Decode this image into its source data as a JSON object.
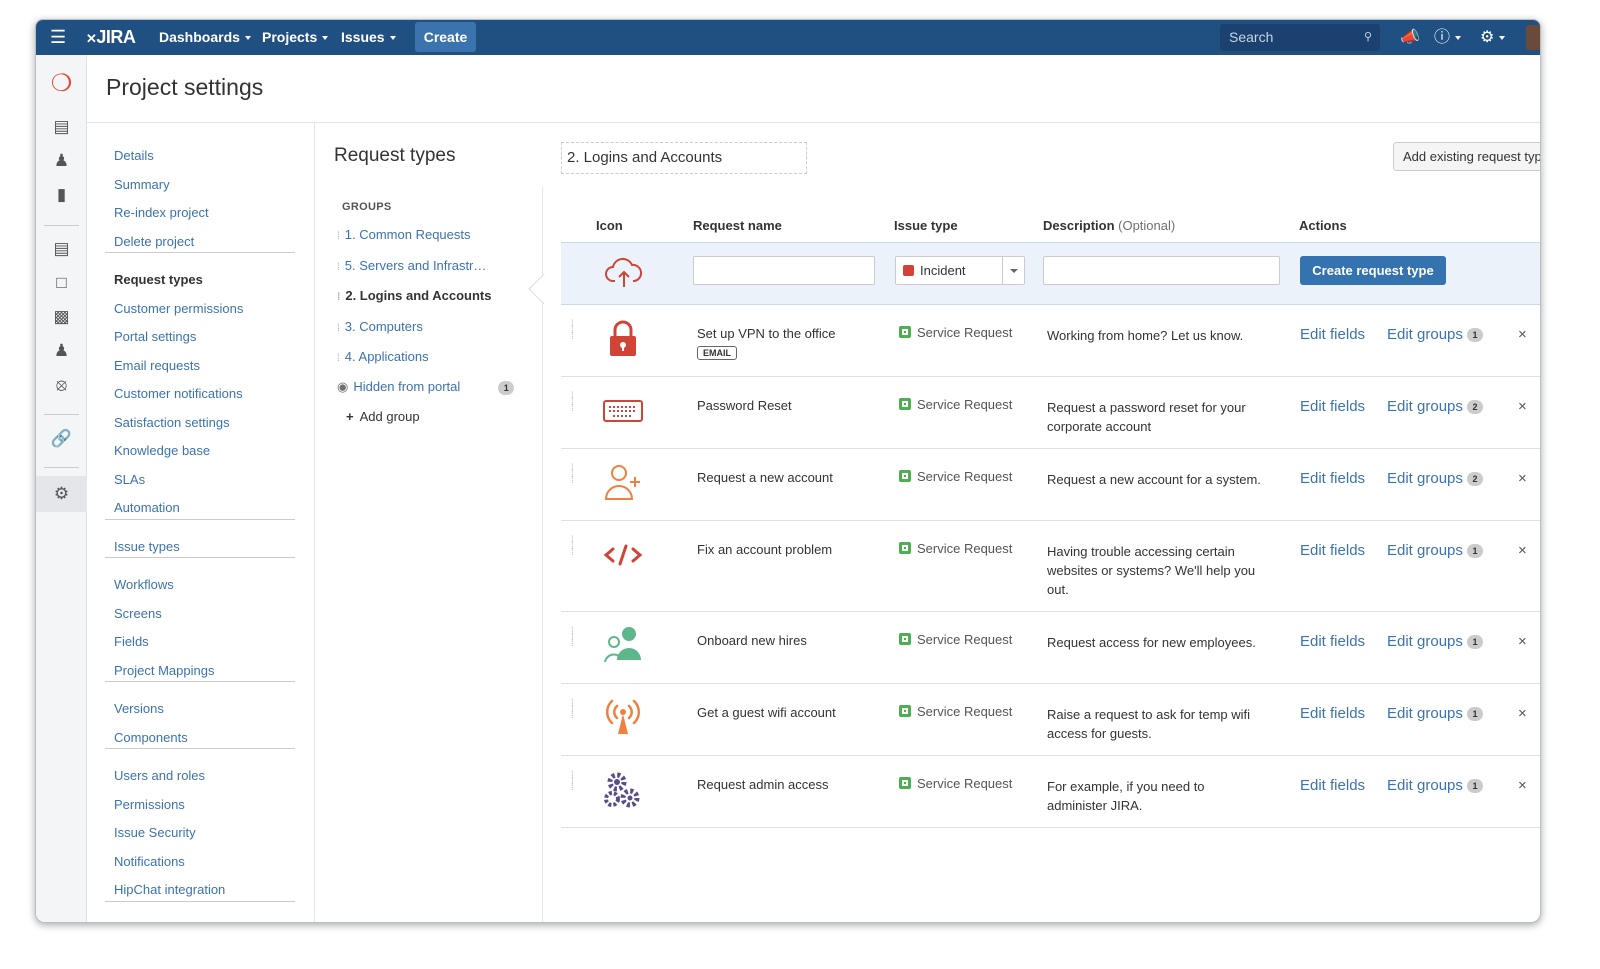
{
  "topbar": {
    "logo": "JIRA",
    "nav": [
      "Dashboards",
      "Projects",
      "Issues"
    ],
    "create": "Create",
    "search_placeholder": "Search"
  },
  "page": {
    "title": "Project settings"
  },
  "settings_nav": [
    [
      "Details",
      "Summary",
      "Re-index project",
      "Delete project"
    ],
    [
      "Request types",
      "Customer permissions",
      "Portal settings",
      "Email requests",
      "Customer notifications",
      "Satisfaction settings",
      "Knowledge base",
      "SLAs",
      "Automation"
    ],
    [
      "Issue types"
    ],
    [
      "Workflows",
      "Screens",
      "Fields",
      "Project Mappings"
    ],
    [
      "Versions",
      "Components"
    ],
    [
      "Users and roles",
      "Permissions",
      "Issue Security",
      "Notifications",
      "HipChat integration"
    ]
  ],
  "request_types": {
    "heading": "Request types",
    "groups_label": "GROUPS",
    "groups": [
      "1. Common Requests",
      "5. Servers and Infrastr…",
      "2. Logins and Accounts",
      "3. Computers",
      "4. Applications"
    ],
    "active_group": "2. Logins and Accounts",
    "hidden_label": "Hidden from portal",
    "hidden_count": "1",
    "add_group": "Add group",
    "group_name": "2. Logins and Accounts",
    "add_existing": "Add existing request typ"
  },
  "table": {
    "headers": {
      "icon": "Icon",
      "name": "Request name",
      "issue_type": "Issue type",
      "description": "Description",
      "optional": "(Optional)",
      "actions": "Actions"
    },
    "new_row": {
      "issue_type": "Incident",
      "create_button": "Create request type"
    },
    "rows": [
      {
        "icon": "lock-icon",
        "color": "#d04437",
        "name": "Set up VPN to the office",
        "tag": "EMAIL",
        "issue_type": "Service Request",
        "description": "Working from home? Let us know.",
        "edit_fields": "Edit fields",
        "edit_groups": "Edit groups",
        "count": "1"
      },
      {
        "icon": "keyboard-icon",
        "color": "#d04437",
        "name": "Password Reset",
        "issue_type": "Service Request",
        "description": "Request a password reset for your corporate account",
        "edit_fields": "Edit fields",
        "edit_groups": "Edit groups",
        "count": "2"
      },
      {
        "icon": "add-user-icon",
        "color": "#f0803c",
        "name": "Request a new account",
        "issue_type": "Service Request",
        "description": "Request a new account for a system.",
        "edit_fields": "Edit fields",
        "edit_groups": "Edit groups",
        "count": "2"
      },
      {
        "icon": "code-icon",
        "color": "#d04437",
        "name": "Fix an account problem",
        "issue_type": "Service Request",
        "description": "Having trouble accessing certain websites or systems? We'll help you out.",
        "edit_fields": "Edit fields",
        "edit_groups": "Edit groups",
        "count": "1"
      },
      {
        "icon": "people-icon",
        "color": "#5cb88a",
        "name": "Onboard new hires",
        "issue_type": "Service Request",
        "description": "Request access for new employees.",
        "edit_fields": "Edit fields",
        "edit_groups": "Edit groups",
        "count": "1"
      },
      {
        "icon": "wifi-icon",
        "color": "#f0803c",
        "name": "Get a guest wifi account",
        "issue_type": "Service Request",
        "description": "Raise a request to ask for temp wifi access for guests.",
        "edit_fields": "Edit fields",
        "edit_groups": "Edit groups",
        "count": "1"
      },
      {
        "icon": "gears-icon",
        "color": "#5b4c8a",
        "name": "Request admin access",
        "issue_type": "Service Request",
        "description": "For example, if you need to administer JIRA.",
        "edit_fields": "Edit fields",
        "edit_groups": "Edit groups",
        "count": "1"
      }
    ]
  },
  "colors": {
    "header": "#205081",
    "link": "#3b73af",
    "primary_button": "#3572b0",
    "service_request": "#4caf50"
  }
}
